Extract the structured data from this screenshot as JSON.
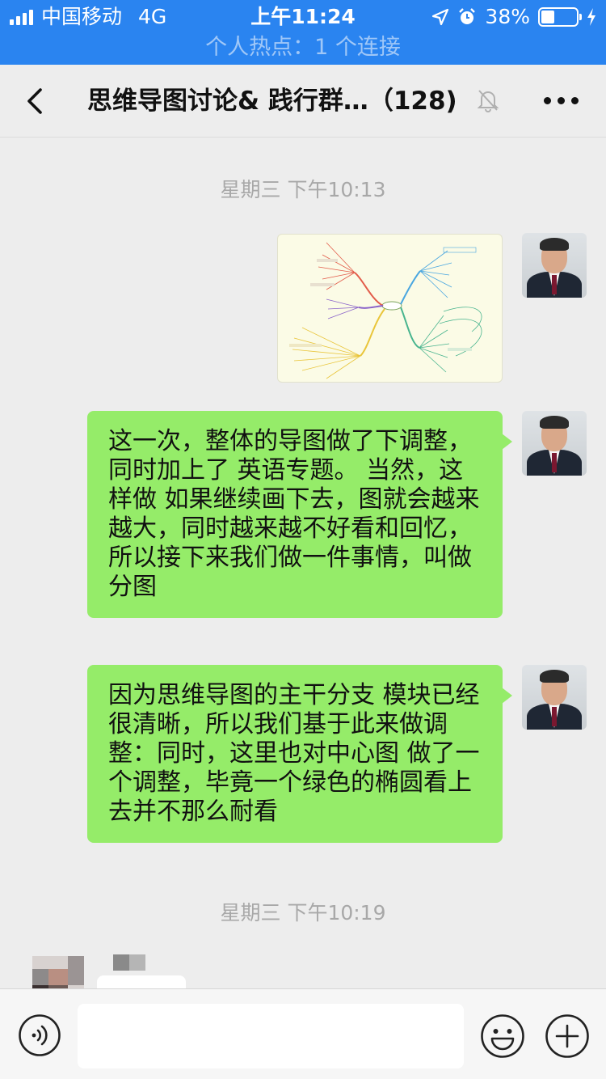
{
  "status_bar": {
    "carrier": "中国移动",
    "network": "4G",
    "time": "上午11:24",
    "battery_percent": "38%",
    "battery_level": 0.38,
    "hotspot": "个人热点：1 个连接"
  },
  "nav": {
    "title": "思维导图讨论& 践行群…（128)"
  },
  "messages": [
    {
      "type": "timestamp",
      "text": "星期三 下午10:13"
    },
    {
      "type": "image",
      "alt": "mind-map"
    },
    {
      "type": "text",
      "text": "这一次，整体的导图做了下调整，同时加上了 英语专题。 当然，这样做 如果继续画下去，图就会越来越大，同时越来越不好看和回忆，所以接下来我们做一件事情，叫做分图"
    },
    {
      "type": "text",
      "text": "因为思维导图的主干分支 模块已经很清晰，所以我们基于此来做调整：同时，这里也对中心图 做了一个调整，毕竟一个绿色的椭圆看上去并不那么耐看"
    },
    {
      "type": "timestamp",
      "text": "星期三 下午10:19"
    }
  ],
  "input": {
    "value": "",
    "placeholder": ""
  },
  "colors": {
    "status_bar": "#2a84f0",
    "bubble_self": "#95ec69",
    "background": "#ededed"
  }
}
